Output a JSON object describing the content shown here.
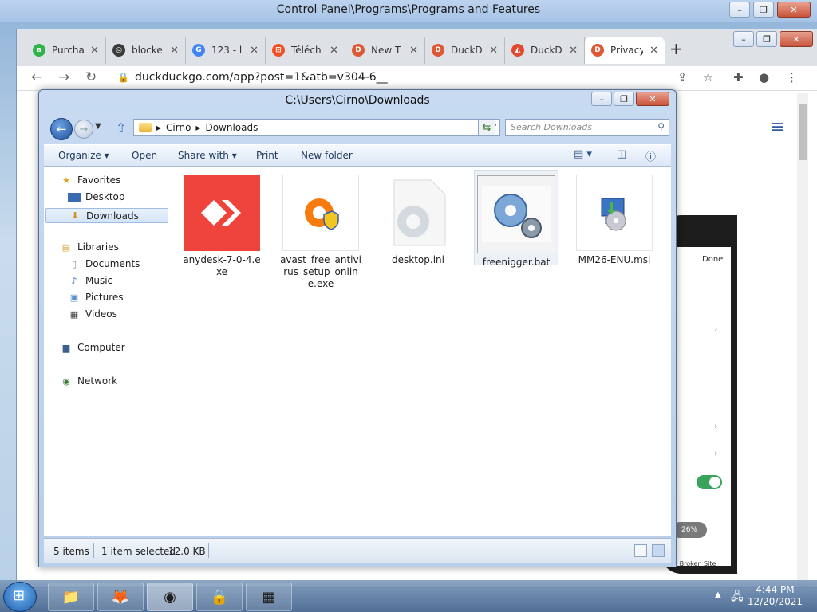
{
  "background_window": {
    "title": "Control Panel\\Programs\\Programs and Features"
  },
  "chrome": {
    "tabs": [
      {
        "label": "Purcha",
        "favicon_color": "#2fb34a",
        "favicon_glyph": "a"
      },
      {
        "label": "blocke",
        "favicon_color": "#3a3a3a",
        "favicon_glyph": "◎"
      },
      {
        "label": "123 - l",
        "favicon_color": "#4285f4",
        "favicon_glyph": "G"
      },
      {
        "label": "Téléch",
        "favicon_color": "#f25022",
        "favicon_glyph": "⊞"
      },
      {
        "label": "New T",
        "favicon_color": "#de5833",
        "favicon_glyph": "D"
      },
      {
        "label": "DuckD",
        "favicon_color": "#de5833",
        "favicon_glyph": "D"
      },
      {
        "label": "DuckD",
        "favicon_color": "#e24a2f",
        "favicon_glyph": "◭"
      },
      {
        "label": "Privacy",
        "favicon_color": "#de5833",
        "favicon_glyph": "D"
      }
    ],
    "url": "duckduckgo.com/app?post=1&atb=v304-6__"
  },
  "phone": {
    "done_label": "Done",
    "pill_label": "26%",
    "broken_site_label": "t Broken Site"
  },
  "explorer": {
    "title": "C:\\Users\\Cirno\\Downloads",
    "breadcrumb": [
      "Cirno",
      "Downloads"
    ],
    "search_placeholder": "Search Downloads",
    "toolbar": {
      "organize": "Organize",
      "open": "Open",
      "share_with": "Share with",
      "print": "Print",
      "new_folder": "New folder"
    },
    "nav": {
      "favorites": "Favorites",
      "desktop": "Desktop",
      "downloads": "Downloads",
      "libraries": "Libraries",
      "documents": "Documents",
      "music": "Music",
      "pictures": "Pictures",
      "videos": "Videos",
      "computer": "Computer",
      "network": "Network"
    },
    "files": [
      {
        "name": "anydesk-7-0-4.exe",
        "icon": "anydesk-icon"
      },
      {
        "name": "avast_free_antivirus_setup_online.exe",
        "icon": "avast-icon"
      },
      {
        "name": "desktop.ini",
        "icon": "settings-file-icon"
      },
      {
        "name": "freenigger.bat",
        "icon": "batch-file-icon"
      },
      {
        "name": "MM26-ENU.msi",
        "icon": "installer-icon"
      }
    ],
    "status": {
      "item_count": "5 items",
      "selection": "1 item selected",
      "size": "12.0 KB"
    }
  },
  "taskbar": {
    "time": "4:44 PM",
    "date": "12/20/2021"
  }
}
